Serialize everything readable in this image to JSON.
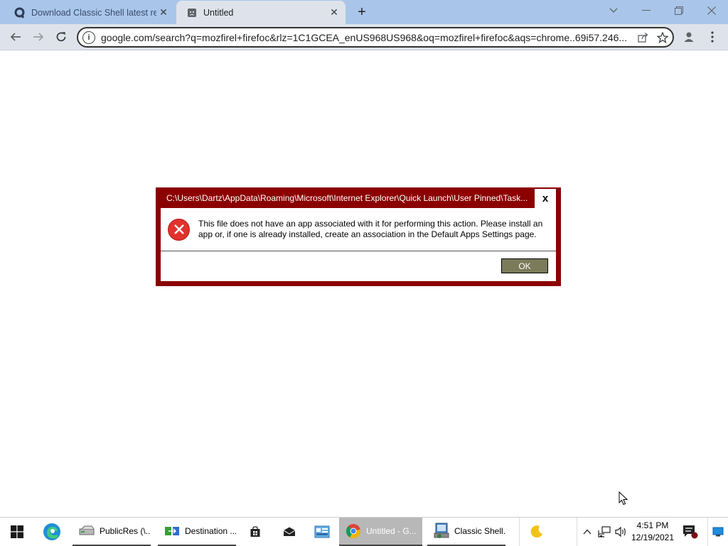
{
  "browser": {
    "tabs": [
      {
        "title": "Download Classic Shell latest rele",
        "active": false
      },
      {
        "title": "Untitled",
        "active": true
      }
    ],
    "address": "google.com/search?q=mozfirel+firefoc&rlz=1C1GCEA_enUS968US968&oq=mozfirel+firefoc&aqs=chrome..69i57.246..."
  },
  "dialog": {
    "title": "C:\\Users\\Dartz\\AppData\\Roaming\\Microsoft\\Internet Explorer\\Quick Launch\\User Pinned\\Task...",
    "message": "This file does not have an app associated with it for performing this action. Please install an app or, if one is already installed, create an association in the Default Apps Settings page.",
    "close_label": "x",
    "ok_label": "OK"
  },
  "taskbar": {
    "items": [
      {
        "label": "PublicRes (\\..."
      },
      {
        "label": "Destination ..."
      },
      {
        "label": "Untitled - G..."
      },
      {
        "label": "Classic Shell..."
      }
    ],
    "time": "4:51 PM",
    "date": "12/19/2021"
  },
  "colors": {
    "dialog_border": "#8b0000",
    "ok_button": "#7b7b5b",
    "tabstrip": "#a9c6ea",
    "error_icon": "#e0322e"
  }
}
